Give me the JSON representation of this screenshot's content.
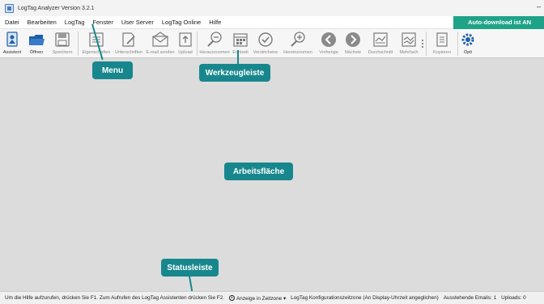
{
  "window": {
    "title": "LogTag Analyzer  Version 3.2.1",
    "minimize_glyph": "–"
  },
  "menu": {
    "items": [
      "Datei",
      "Bearbeiten",
      "LogTag",
      "Fenster",
      "User Server",
      "LogTag Online",
      "Hilfe"
    ],
    "autodownload_banner": "Auto-download ist AN"
  },
  "toolbar": {
    "buttons": [
      {
        "label": "Assistent",
        "icon": "wizard-icon"
      },
      {
        "label": "Öffnen",
        "icon": "folder-open-icon"
      },
      {
        "label": "Speichern",
        "icon": "save-icon"
      },
      {
        "label": "Eigenschaften",
        "icon": "properties-icon"
      },
      {
        "label": "Unterschriften",
        "icon": "signature-icon"
      },
      {
        "label": "E-mail senden",
        "icon": "envelope-icon"
      },
      {
        "label": "Upload",
        "icon": "upload-icon"
      },
      {
        "label": "Herauszoomen",
        "icon": "zoom-out-icon"
      },
      {
        "label": "Echtzeit",
        "icon": "calendar-icon"
      },
      {
        "label": "Verstrichene",
        "icon": "elapsed-clock-icon"
      },
      {
        "label": "Hereinzoomen",
        "icon": "zoom-in-icon"
      },
      {
        "label": "Vorherige",
        "icon": "previous-icon"
      },
      {
        "label": "Nächste",
        "icon": "next-icon"
      },
      {
        "label": "Durchschnitt",
        "icon": "average-chart-icon"
      },
      {
        "label": "Mehrfach",
        "icon": "multiple-chart-icon"
      },
      {
        "label": "Kopieren",
        "icon": "copy-icon"
      },
      {
        "label": "Opti",
        "icon": "gear-icon"
      }
    ]
  },
  "callouts": {
    "menu": "Menu",
    "toolbar": "Werkzeugleiste",
    "workspace": "Arbeitsfläche",
    "statusbar": "Statusleiste"
  },
  "statusbar": {
    "help_text": "Um die Hilfe aufzurufen, drücken Sie F1. Zum Aufrufen des LogTag Assistenten drücken Sie F2.",
    "timezone_toggle": "Anzeige in Zeitzone",
    "timezone_value": "LogTag Konfigurationszeitzone (An Display-Uhrzeit angeglichen)",
    "pending_emails": "Ausstehende Emails: 1",
    "uploads": "Uploads: 0"
  },
  "colors": {
    "accent": "#1fa388",
    "callout": "#17878d",
    "icon_gray": "#8a8a8a",
    "icon_blue": "#1f5fa8"
  }
}
